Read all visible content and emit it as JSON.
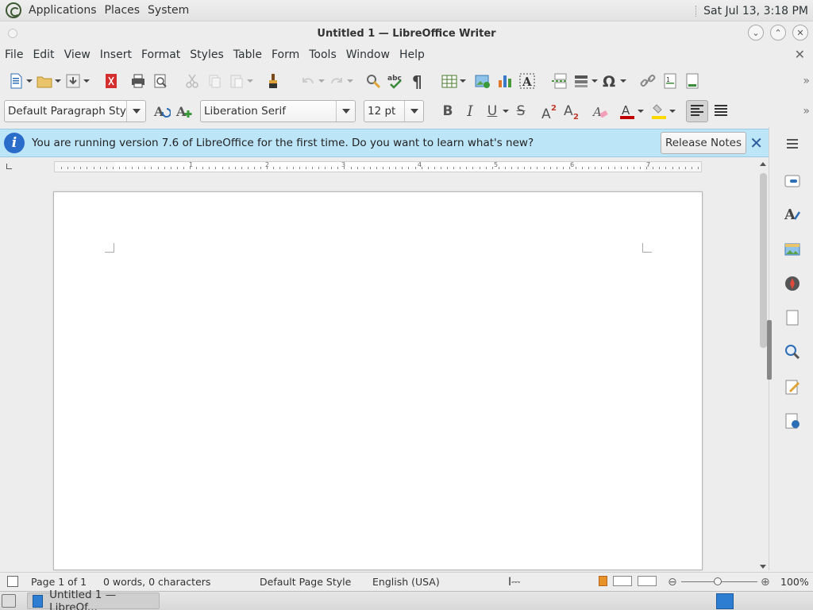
{
  "top_panel": {
    "menus": [
      "Applications",
      "Places",
      "System"
    ],
    "clock": "Sat Jul 13,  3:18 PM"
  },
  "window": {
    "title": "Untitled 1 — LibreOffice Writer"
  },
  "menubar": {
    "items": [
      "File",
      "Edit",
      "View",
      "Insert",
      "Format",
      "Styles",
      "Table",
      "Form",
      "Tools",
      "Window",
      "Help"
    ]
  },
  "formatting": {
    "paragraph_style": "Default Paragraph Style",
    "font_name": "Liberation Serif",
    "font_size": "12 pt"
  },
  "infobar": {
    "message": "You are running version 7.6 of LibreOffice for the first time. Do you want to learn what's new?",
    "button_label": "Release Notes"
  },
  "ruler": {
    "numbers": [
      "1",
      "2",
      "3",
      "4",
      "5",
      "6",
      "7"
    ]
  },
  "statusbar": {
    "page": "Page 1 of 1",
    "word_count": "0 words, 0 characters",
    "page_style": "Default Page Style",
    "language": "English (USA)",
    "zoom": "100%"
  },
  "taskbar": {
    "window_button": "Untitled 1 — LibreOf..."
  },
  "colors": {
    "infobar_bg": "#bde5f8",
    "info_icon": "#2a6cc9",
    "font_color_bar": "#c00000",
    "highlight_bar": "#ffd800"
  }
}
